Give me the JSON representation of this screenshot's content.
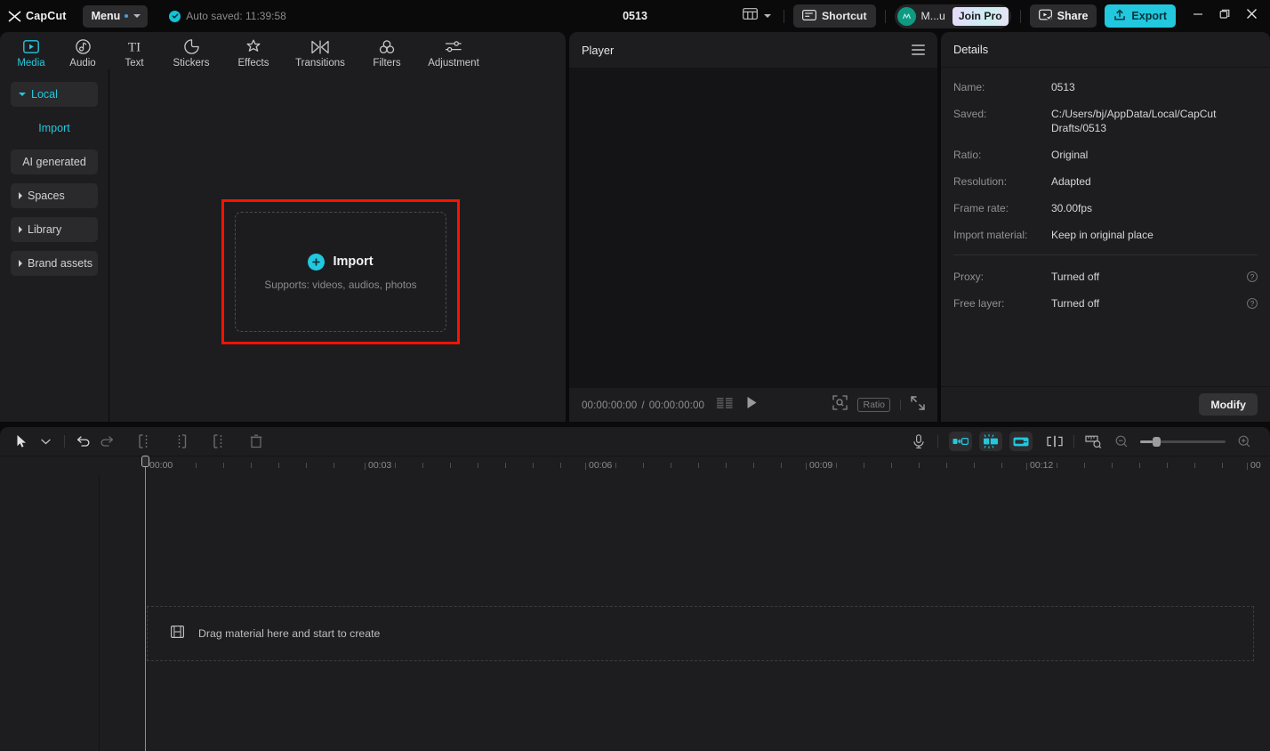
{
  "titlebar": {
    "app_name": "CapCut",
    "menu_label": "Menu",
    "autosave_text": "Auto saved: 11:39:58",
    "project_title": "0513",
    "shortcut_label": "Shortcut",
    "account_name": "M...u",
    "join_pro_label": "Join Pro",
    "share_label": "Share",
    "export_label": "Export",
    "minimize_icon": "minimize-icon",
    "maximize_icon": "maximize-icon",
    "close_icon": "close-icon",
    "layout_icon": "layout-icon",
    "accent_color": "#22c8de"
  },
  "media": {
    "tabs": [
      {
        "label": "Media",
        "icon": "media-icon",
        "active": true
      },
      {
        "label": "Audio",
        "icon": "audio-icon",
        "active": false
      },
      {
        "label": "Text",
        "icon": "text-icon",
        "active": false
      },
      {
        "label": "Stickers",
        "icon": "stickers-icon",
        "active": false
      },
      {
        "label": "Effects",
        "icon": "effects-icon",
        "active": false
      },
      {
        "label": "Transitions",
        "icon": "transitions-icon",
        "active": false
      },
      {
        "label": "Filters",
        "icon": "filters-icon",
        "active": false
      },
      {
        "label": "Adjustment",
        "icon": "adjustment-icon",
        "active": false
      }
    ],
    "nav": [
      {
        "label": "Local",
        "state": "expanded",
        "accent": true
      },
      {
        "label": "Import",
        "state": "sub",
        "accent": true
      },
      {
        "label": "AI generated",
        "state": "sub-plain",
        "accent": false
      },
      {
        "label": "Spaces",
        "state": "collapsed",
        "accent": false
      },
      {
        "label": "Library",
        "state": "collapsed",
        "accent": false
      },
      {
        "label": "Brand assets",
        "state": "collapsed",
        "accent": false
      }
    ],
    "import": {
      "label": "Import",
      "sub": "Supports: videos, audios, photos",
      "highlight_color": "#fe1100"
    }
  },
  "player": {
    "title": "Player",
    "menu_icon": "hamburger-icon",
    "current_time": "00:00:00:00",
    "total_time": "00:00:00:00",
    "time_separator": "/",
    "play_icon": "play-icon",
    "frames_icon": "frames-icon",
    "zoom_icon": "zoom-fit-icon",
    "ratio_label": "Ratio",
    "fullscreen_icon": "fullscreen-icon"
  },
  "details": {
    "title": "Details",
    "rows": [
      {
        "key": "Name:",
        "value": "0513"
      },
      {
        "key": "Saved:",
        "value": "C:/Users/bj/AppData/Local/CapCut Drafts/0513"
      },
      {
        "key": "Ratio:",
        "value": "Original"
      },
      {
        "key": "Resolution:",
        "value": "Adapted"
      },
      {
        "key": "Frame rate:",
        "value": "30.00fps"
      },
      {
        "key": "Import material:",
        "value": "Keep in original place"
      }
    ],
    "rows2": [
      {
        "key": "Proxy:",
        "value": "Turned off",
        "help": "?"
      },
      {
        "key": "Free layer:",
        "value": "Turned off",
        "help": "?"
      }
    ],
    "modify_label": "Modify"
  },
  "timeline": {
    "tools": [
      {
        "name": "select-tool-icon"
      },
      {
        "name": "chevron-down-icon"
      },
      {
        "name": "undo-icon"
      },
      {
        "name": "redo-icon"
      },
      {
        "name": "split-icon"
      },
      {
        "name": "trim-left-icon"
      },
      {
        "name": "trim-right-icon"
      },
      {
        "name": "delete-icon"
      }
    ],
    "right_tools": [
      {
        "name": "microphone-icon"
      },
      {
        "name": "mirror-icon"
      },
      {
        "name": "auto-cut-icon"
      },
      {
        "name": "crop-icon"
      },
      {
        "name": "keyframe-icon"
      },
      {
        "name": "measure-icon"
      }
    ],
    "ruler_labels": [
      "00:00",
      "00:03",
      "00:06",
      "00:09",
      "00:12",
      "00"
    ],
    "dropzone_text": "Drag material here and start to create",
    "dropzone_icon": "film-strip-icon",
    "zoom_out_icon": "zoom-out-icon",
    "zoom_in_icon": "zoom-in-icon"
  }
}
